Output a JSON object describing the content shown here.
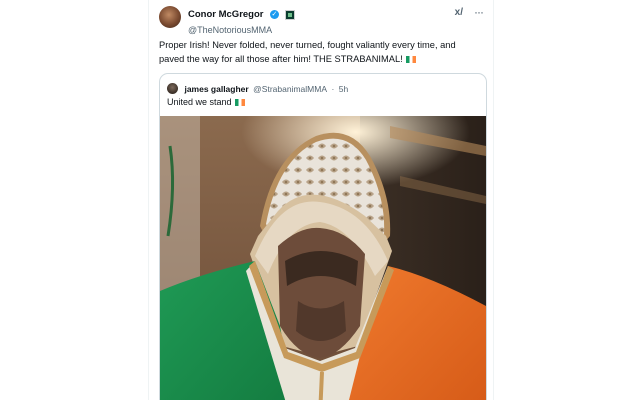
{
  "tweet": {
    "author_name": "Conor McGregor",
    "author_handle": "@TheNotoriousMMA",
    "verified_mark": "✓",
    "text": "Proper Irish! Never folded, never turned, fought valiantly every time, and paved the way for all those after him! THE STRABANIMAL!",
    "grok_icon": "x-grok-icon",
    "grok_glyph": "x/",
    "more_icon": "more-options-icon",
    "more_glyph": "···"
  },
  "quote": {
    "author_name": "james gallagher",
    "author_handle": "@StrabanimalMMA",
    "separator": "·",
    "time": "5h",
    "text": "United we stand",
    "media_icon": "photo"
  },
  "colors": {
    "accent": "#1d9bf0",
    "text": "#0f1419",
    "muted": "#536471",
    "border": "#cfd9de",
    "flag_green": "#169b62",
    "flag_orange": "#ff883e"
  }
}
